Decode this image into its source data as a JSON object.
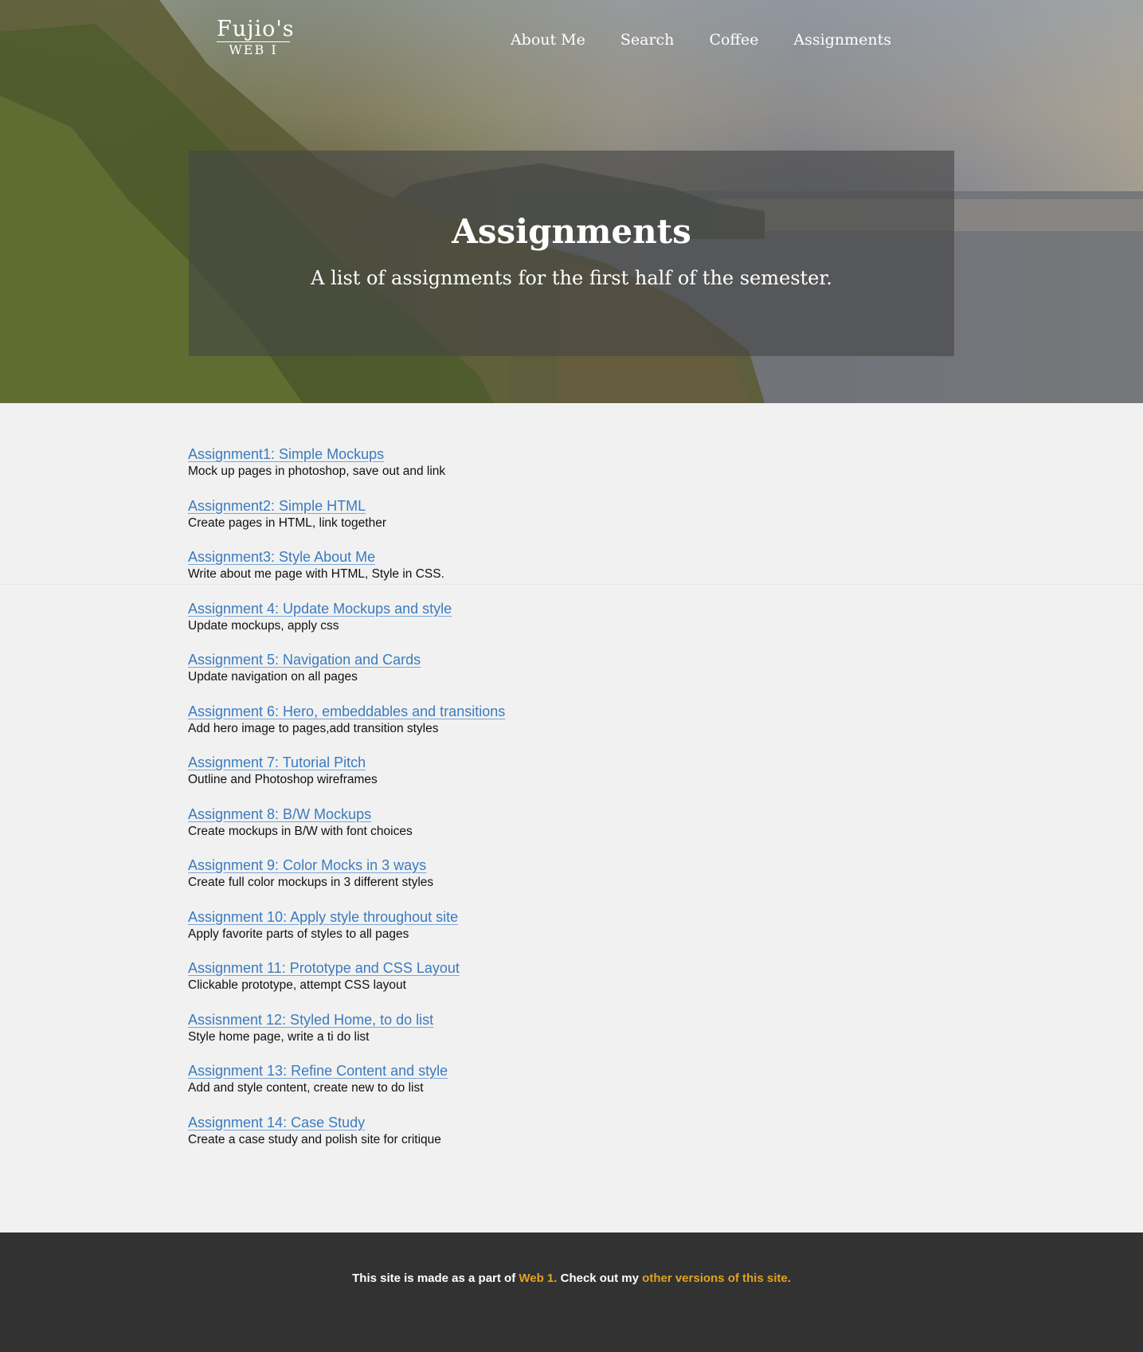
{
  "brand": {
    "line1": "Fujio's",
    "line2": "WEB I"
  },
  "nav": [
    {
      "label": "About Me"
    },
    {
      "label": "Search"
    },
    {
      "label": "Coffee"
    },
    {
      "label": "Assignments"
    }
  ],
  "hero": {
    "title": "Assignments",
    "subtitle": "A list of assignments for the first half of the semester."
  },
  "assignments": [
    {
      "title": "Assignment1: Simple Mockups",
      "desc": "Mock up pages in photoshop, save out and link"
    },
    {
      "title": "Assignment2: Simple HTML ",
      "desc": "Create pages in HTML, link together"
    },
    {
      "title": "Assignment3: Style About Me",
      "desc": "Write about me page with HTML, Style in CSS."
    },
    {
      "title": "Assignment 4: Update Mockups and style",
      "desc": "Update mockups, apply css"
    },
    {
      "title": "Assignment 5: Navigation and Cards",
      "desc": "Update navigation on all pages"
    },
    {
      "title": "Assignment 6: Hero, embeddables and transitions",
      "desc": "Add hero image to pages,add transition styles"
    },
    {
      "title": "Assignment 7: Tutorial Pitch",
      "desc": "Outline and Photoshop wireframes"
    },
    {
      "title": "Assignment 8: B/W Mockups",
      "desc": "Create mockups in B/W with font choices"
    },
    {
      "title": "Assignment 9: Color Mocks in 3 ways",
      "desc": "Create full color mockups in 3 different styles"
    },
    {
      "title": "Assignment 10: Apply style throughout site",
      "desc": "Apply favorite parts of styles to all pages"
    },
    {
      "title": "Assignment 11: Prototype and CSS Layout",
      "desc": "Clickable prototype, attempt CSS layout"
    },
    {
      "title": "Assisnment 12: Styled Home, to do list",
      "desc": "Style home page, write a ti do list"
    },
    {
      "title": "Assignment 13: Refine Content and style",
      "desc": "Add and style content, create new to do list"
    },
    {
      "title": "Assignment 14: Case Study",
      "desc": "Create a case study and polish site for critique"
    }
  ],
  "footer": {
    "text1": "This site is made as a part of ",
    "link1": "Web 1.",
    "text2": " Check out my ",
    "link2": "other versions of this site.",
    "link_color": "#e2a21c"
  },
  "colors": {
    "link": "#3b7bbf",
    "footer_bg": "#323232",
    "page_bg": "#f1f1f1"
  }
}
